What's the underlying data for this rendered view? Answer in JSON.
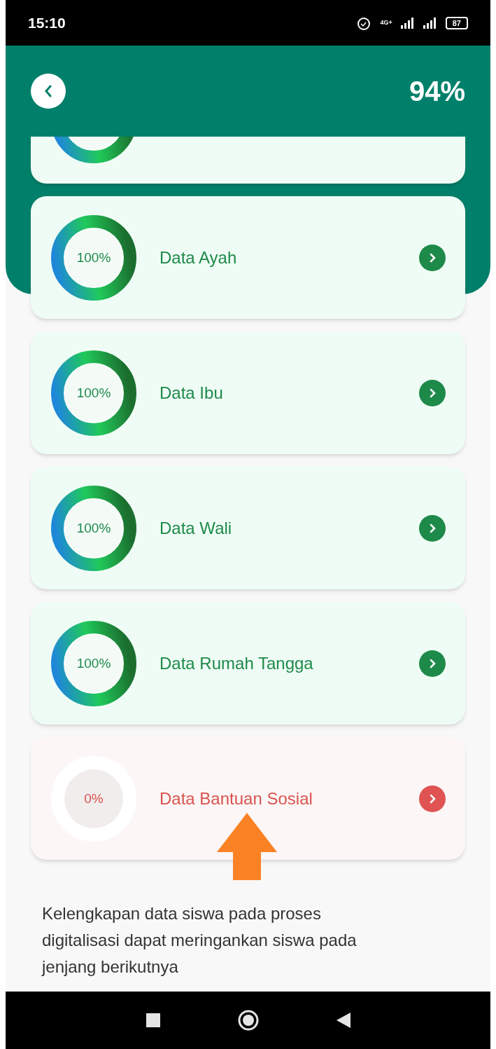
{
  "status_bar": {
    "time": "15:10",
    "network": "4G+",
    "battery": "87"
  },
  "header": {
    "total": "94%"
  },
  "cards": [
    {
      "percent": "100%",
      "label": "Data Ayah",
      "kind": "complete"
    },
    {
      "percent": "100%",
      "label": "Data Ibu",
      "kind": "complete"
    },
    {
      "percent": "100%",
      "label": "Data Wali",
      "kind": "complete"
    },
    {
      "percent": "100%",
      "label": "Data Rumah Tangga",
      "kind": "complete"
    },
    {
      "percent": "0%",
      "label": "Data Bantuan Sosial",
      "kind": "incomplete"
    }
  ],
  "note": "Kelengkapan data siswa pada proses digitalisasi dapat meringankan siswa pada jenjang berikutnya"
}
